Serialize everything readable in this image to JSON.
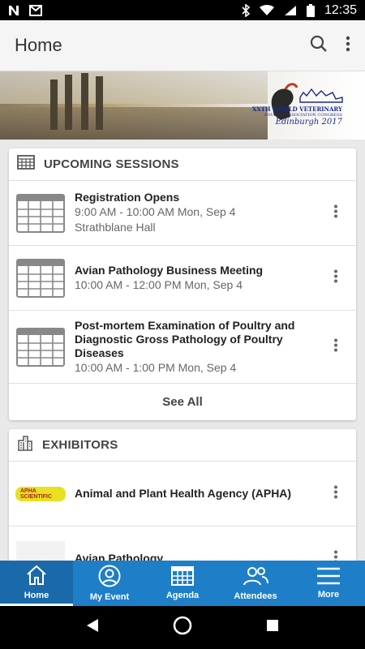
{
  "status_bar": {
    "time": "12:35",
    "left_icons": [
      "n-icon",
      "mail-icon"
    ],
    "right_icons": [
      "bluetooth-icon",
      "wifi-icon",
      "signal-icon",
      "battery-icon"
    ]
  },
  "app_bar": {
    "title": "Home",
    "icons": [
      "search-icon",
      "more-vert-icon"
    ]
  },
  "banner": {
    "logo_line1": "XXTH WORLD VETERINARY",
    "logo_line2": "POULTRY ASSOCIATION CONGRESS",
    "logo_line3": "Edinburgh 2017"
  },
  "upcoming_sessions": {
    "header": "UPCOMING SESSIONS",
    "items": [
      {
        "title": "Registration Opens",
        "time": "9:00 AM - 10:00 AM Mon, Sep 4",
        "location": "Strathblane Hall"
      },
      {
        "title": "Avian Pathology Business Meeting",
        "time": "10:00 AM - 12:00 PM Mon, Sep 4",
        "location": ""
      },
      {
        "title": "Post-mortem Examination of Poultry and Diagnostic Gross Pathology of Poultry Diseases",
        "time": "10:00 AM - 1:00 PM Mon, Sep 4",
        "location": ""
      }
    ],
    "see_all": "See All"
  },
  "exhibitors": {
    "header": "EXHIBITORS",
    "items": [
      {
        "name": "Animal and Plant Health Agency (APHA)",
        "logo_text": "APHA SCIENTIFIC"
      },
      {
        "name": "Avian Pathology",
        "logo_text": ""
      }
    ]
  },
  "bottom_nav": [
    {
      "label": "Home",
      "icon": "home-icon",
      "active": true
    },
    {
      "label": "My Event",
      "icon": "person-icon",
      "active": false
    },
    {
      "label": "Agenda",
      "icon": "calendar-icon",
      "active": false
    },
    {
      "label": "Attendees",
      "icon": "people-icon",
      "active": false
    },
    {
      "label": "More",
      "icon": "menu-icon",
      "active": false
    }
  ],
  "colors": {
    "accent": "#1e7fc8",
    "active_tab": "#1a6aab",
    "app_bar": "#f5f5f5",
    "background": "#e9e9e9"
  }
}
